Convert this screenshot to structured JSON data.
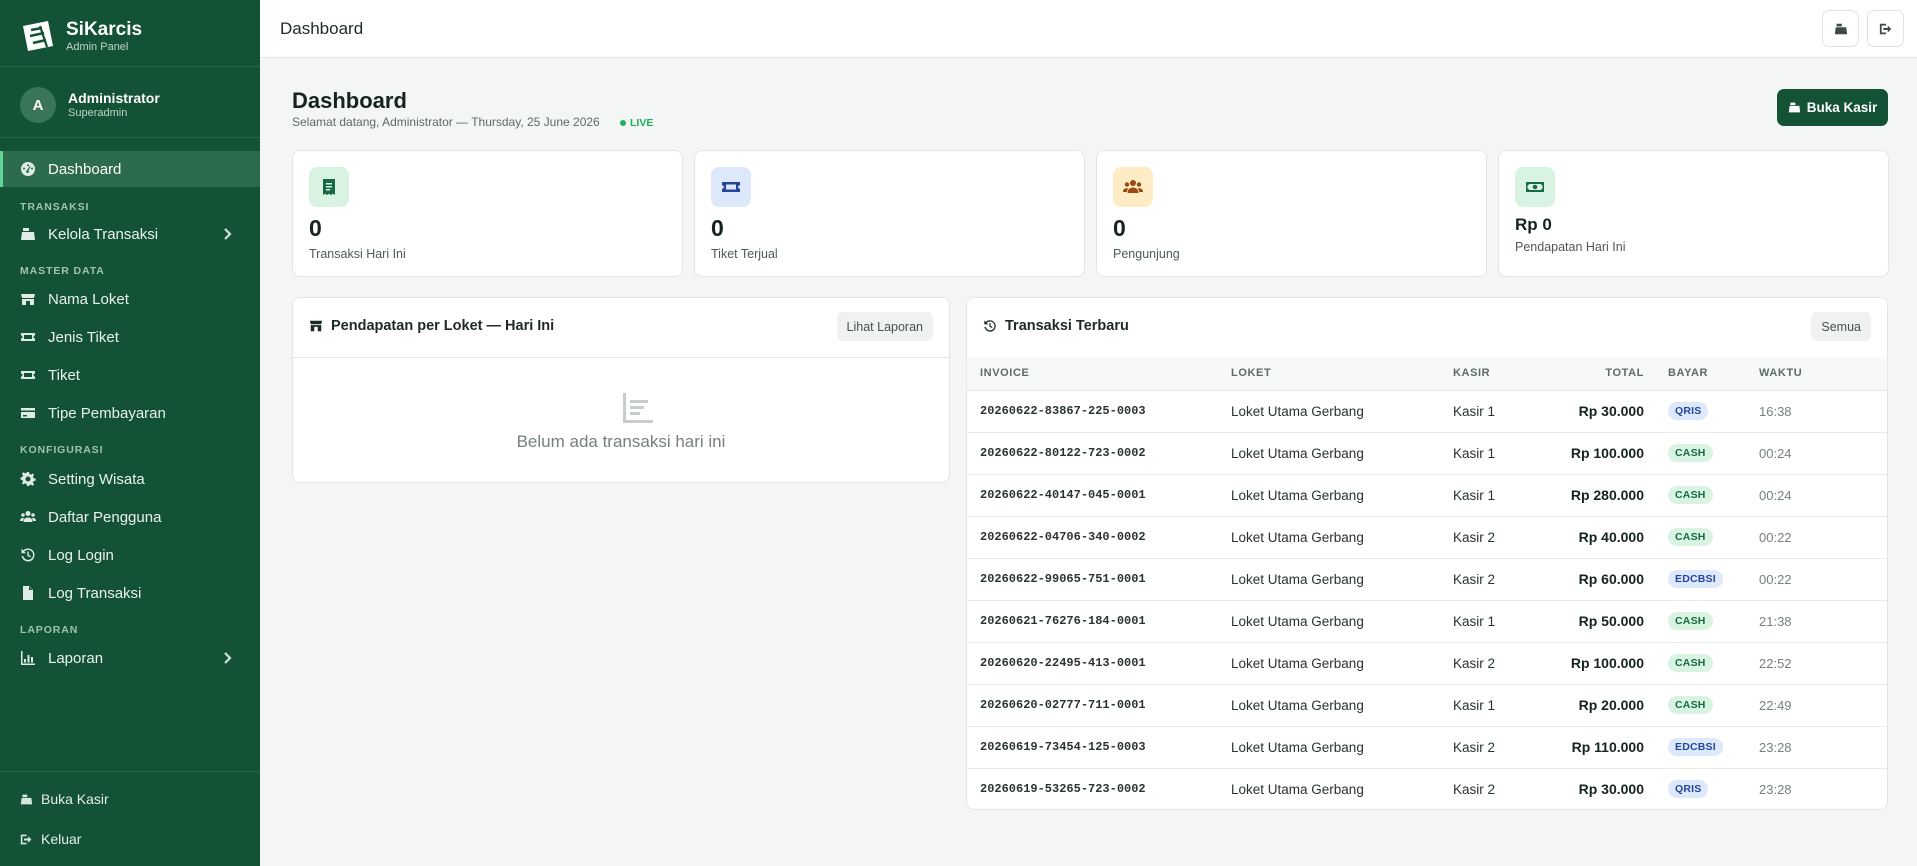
{
  "brand": {
    "name": "SiKarcis",
    "subtitle": "Admin Panel"
  },
  "user": {
    "initial": "A",
    "name": "Administrator",
    "role": "Superadmin"
  },
  "nav": {
    "dashboard": "Dashboard",
    "section_transaksi": "TRANSAKSI",
    "kelola_transaksi": "Kelola Transaksi",
    "section_master": "MASTER DATA",
    "nama_loket": "Nama Loket",
    "jenis_tiket": "Jenis Tiket",
    "tiket": "Tiket",
    "tipe_pembayaran": "Tipe Pembayaran",
    "section_konfigurasi": "KONFIGURASI",
    "setting_wisata": "Setting Wisata",
    "daftar_pengguna": "Daftar Pengguna",
    "log_login": "Log Login",
    "log_transaksi": "Log Transaksi",
    "section_laporan": "LAPORAN",
    "laporan": "Laporan"
  },
  "sidebar_footer": {
    "buka_kasir": "Buka Kasir",
    "keluar": "Keluar"
  },
  "topbar": {
    "title": "Dashboard"
  },
  "header": {
    "title": "Dashboard",
    "subtitle": "Selamat datang, Administrator — Thursday, 25 June 2026",
    "live": "LIVE",
    "buka_kasir": "Buka Kasir"
  },
  "stats": [
    {
      "value": "0",
      "label": "Transaksi Hari Ini",
      "icon": "receipt-icon"
    },
    {
      "value": "0",
      "label": "Tiket Terjual",
      "icon": "ticket-icon"
    },
    {
      "value": "0",
      "label": "Pengunjung",
      "icon": "users-icon"
    },
    {
      "value": "Rp 0",
      "label": "Pendapatan Hari Ini",
      "icon": "money-icon"
    }
  ],
  "revenue_panel": {
    "title": "Pendapatan per Loket — Hari Ini",
    "button": "Lihat Laporan",
    "empty": "Belum ada transaksi hari ini"
  },
  "tx_panel": {
    "title": "Transaksi Terbaru",
    "button": "Semua",
    "columns": {
      "invoice": "INVOICE",
      "loket": "LOKET",
      "kasir": "KASIR",
      "total": "TOTAL",
      "bayar": "BAYAR",
      "waktu": "WAKTU"
    },
    "rows": [
      {
        "invoice": "20260622-83867-225-0003",
        "loket": "Loket Utama Gerbang",
        "kasir": "Kasir 1",
        "total": "Rp 30.000",
        "bayar": "QRIS",
        "waktu": "16:38"
      },
      {
        "invoice": "20260622-80122-723-0002",
        "loket": "Loket Utama Gerbang",
        "kasir": "Kasir 1",
        "total": "Rp 100.000",
        "bayar": "CASH",
        "waktu": "00:24"
      },
      {
        "invoice": "20260622-40147-045-0001",
        "loket": "Loket Utama Gerbang",
        "kasir": "Kasir 1",
        "total": "Rp 280.000",
        "bayar": "CASH",
        "waktu": "00:24"
      },
      {
        "invoice": "20260622-04706-340-0002",
        "loket": "Loket Utama Gerbang",
        "kasir": "Kasir 2",
        "total": "Rp 40.000",
        "bayar": "CASH",
        "waktu": "00:22"
      },
      {
        "invoice": "20260622-99065-751-0001",
        "loket": "Loket Utama Gerbang",
        "kasir": "Kasir 2",
        "total": "Rp 60.000",
        "bayar": "EDCBSI",
        "waktu": "00:22"
      },
      {
        "invoice": "20260621-76276-184-0001",
        "loket": "Loket Utama Gerbang",
        "kasir": "Kasir 1",
        "total": "Rp 50.000",
        "bayar": "CASH",
        "waktu": "21:38"
      },
      {
        "invoice": "20260620-22495-413-0001",
        "loket": "Loket Utama Gerbang",
        "kasir": "Kasir 2",
        "total": "Rp 100.000",
        "bayar": "CASH",
        "waktu": "22:52"
      },
      {
        "invoice": "20260620-02777-711-0001",
        "loket": "Loket Utama Gerbang",
        "kasir": "Kasir 1",
        "total": "Rp 20.000",
        "bayar": "CASH",
        "waktu": "22:49"
      },
      {
        "invoice": "20260619-73454-125-0003",
        "loket": "Loket Utama Gerbang",
        "kasir": "Kasir 2",
        "total": "Rp 110.000",
        "bayar": "EDCBSI",
        "waktu": "23:28"
      },
      {
        "invoice": "20260619-53265-723-0002",
        "loket": "Loket Utama Gerbang",
        "kasir": "Kasir 2",
        "total": "Rp 30.000",
        "bayar": "QRIS",
        "waktu": "23:28"
      }
    ]
  },
  "colors": {
    "sidebar": "#145235",
    "accent": "#5fd598",
    "primary_button": "#145235"
  }
}
